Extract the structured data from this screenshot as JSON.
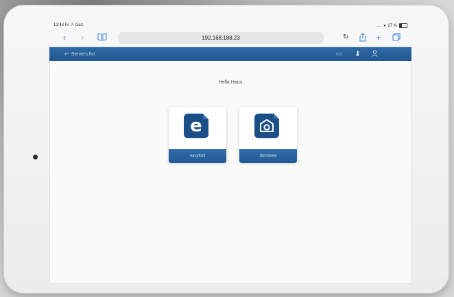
{
  "status_bar": {
    "time": "13:43",
    "date": "Fr. 7. Dez.",
    "battery": "27 %"
  },
  "browser": {
    "url": "192.168.188.23"
  },
  "app_header": {
    "back_label": "Servers list"
  },
  "main": {
    "site_title": "Hella Haus",
    "tiles": [
      {
        "label": "easytool",
        "icon": "e-logo-icon"
      },
      {
        "label": "domovea",
        "icon": "camera-house-icon"
      }
    ]
  },
  "colors": {
    "header_blue": "#2d6aa8",
    "tile_blue": "#1c4f87",
    "link_blue": "#3a7fd9"
  }
}
